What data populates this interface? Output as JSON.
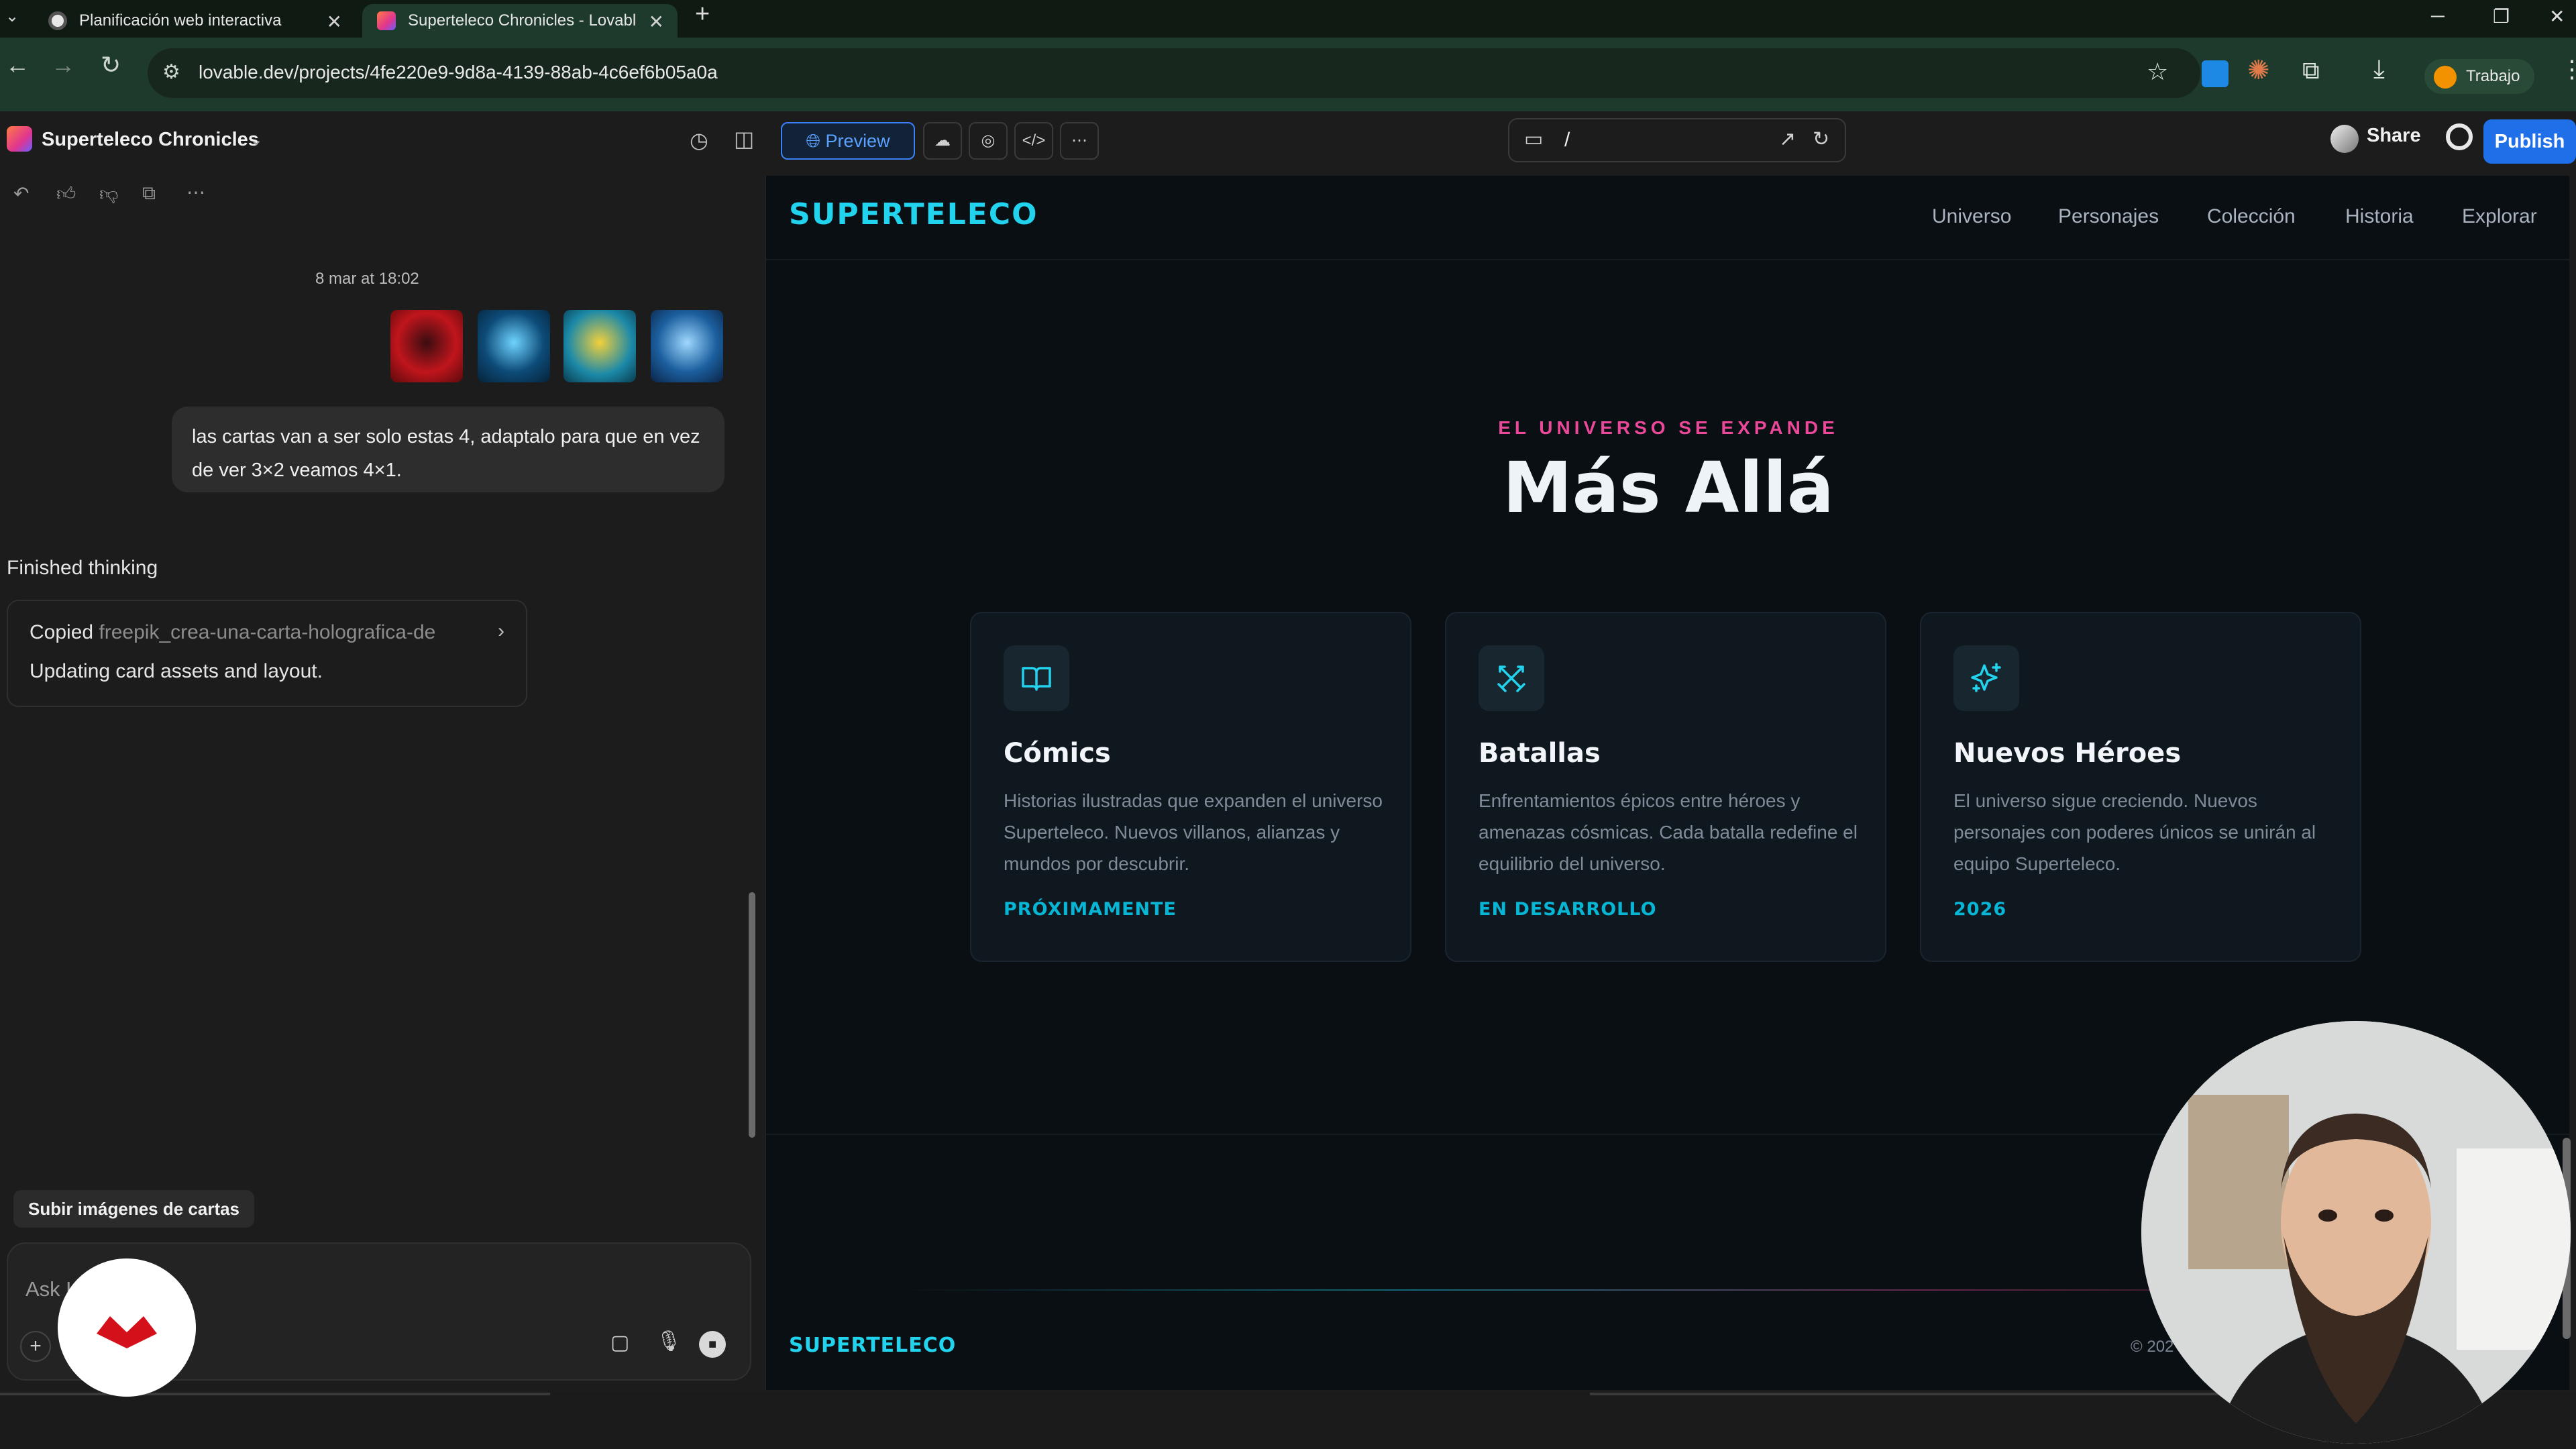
{
  "browser": {
    "tabs": [
      {
        "title": "Planificación web interactiva",
        "active": false
      },
      {
        "title": "Superteleco Chronicles - Lovabl",
        "active": true
      }
    ],
    "url": "lovable.dev/projects/4fe220e9-9d8a-4139-88ab-4c6ef6b05a0a",
    "profile_label": "Trabajo"
  },
  "editor": {
    "project_title": "Superteleco Chronicles",
    "preview_label": "Preview",
    "route": "/",
    "share_label": "Share",
    "publish_label": "Publish"
  },
  "chat": {
    "timestamp": "8 mar at 18:02",
    "user_message": "las cartas van a ser solo estas 4, adaptalo para que en vez de ver 3×2 veamos 4×1.",
    "finished_label": "Finished thinking",
    "copied_prefix": "Copied ",
    "copied_file": "freepik_crea-una-carta-holografica-de",
    "updating_text": "Updating card assets and layout.",
    "suggestion_chip": "Subir imágenes de cartas",
    "input_placeholder": "Ask L"
  },
  "site": {
    "brand": "SUPERTELECO",
    "nav": [
      "Universo",
      "Personajes",
      "Colección",
      "Historia",
      "Explorar"
    ],
    "eyebrow": "EL UNIVERSO SE EXPANDE",
    "title": "Más Allá",
    "cards": [
      {
        "icon": "book-open-icon",
        "title": "Cómics",
        "description": "Historias ilustradas que expanden el universo Superteleco. Nuevos villanos, alianzas y mundos por descubrir.",
        "tag": "PRÓXIMAMENTE"
      },
      {
        "icon": "swords-icon",
        "title": "Batallas",
        "description": "Enfrentamientos épicos entre héroes y amenazas cósmicas. Cada batalla redefine el equilibrio del universo.",
        "tag": "EN DESARROLLO"
      },
      {
        "icon": "sparkles-icon",
        "title": "Nuevos Héroes",
        "description": "El universo sigue creciendo. Nuevos personajes con poderes únicos se unirán al equipo Superteleco.",
        "tag": "2026"
      }
    ],
    "footer_brand": "SUPERTELECO",
    "copyright": "© 202"
  },
  "colors": {
    "accent_cyan": "#22d3ee",
    "accent_pink": "#ec4899",
    "publish_blue": "#1f6fe8",
    "site_bg": "#0a0f14"
  }
}
